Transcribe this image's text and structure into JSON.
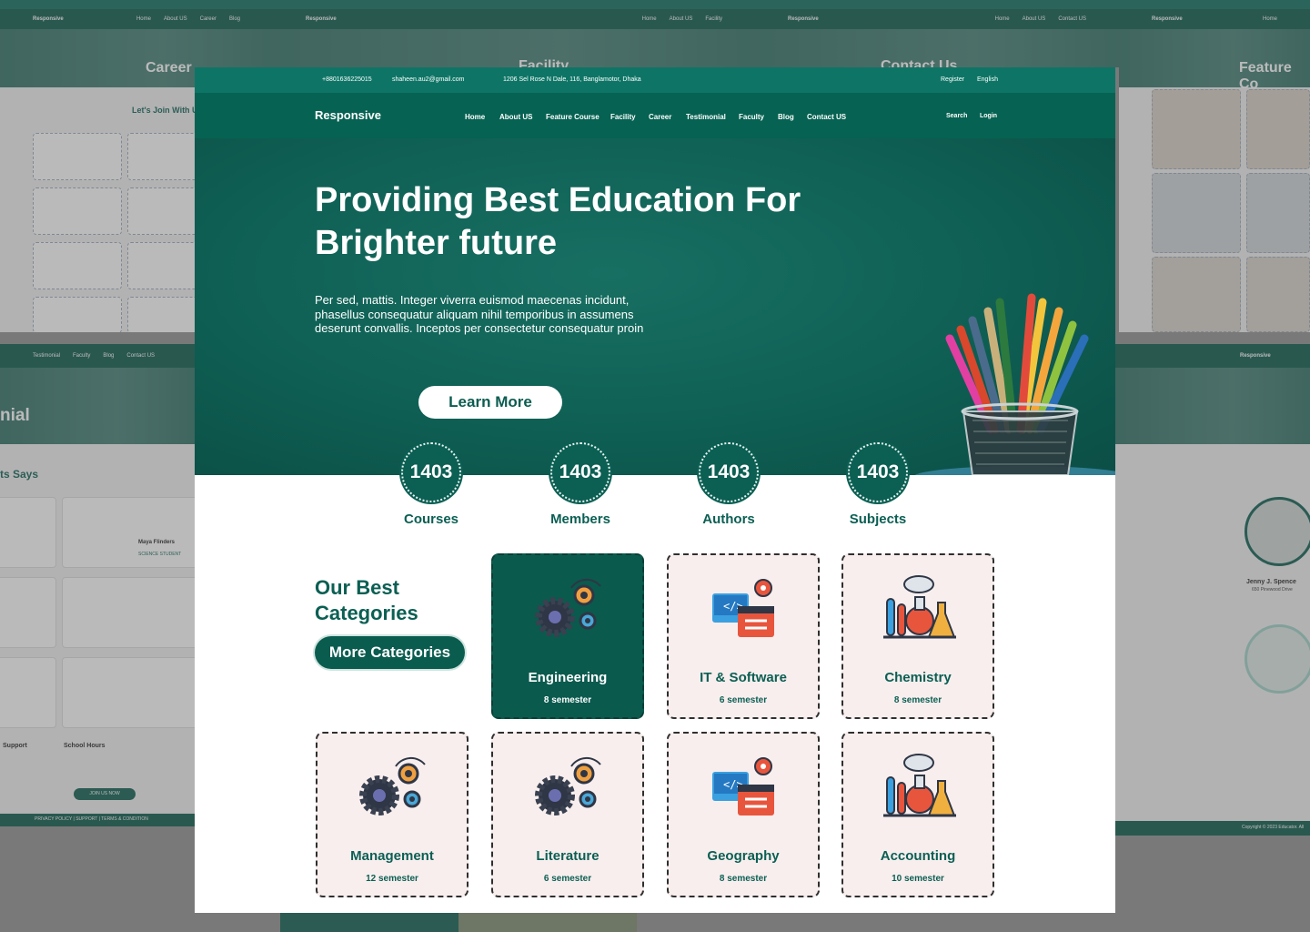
{
  "topbar": {
    "phone": "+8801636225015",
    "email": "shaheen.au2@gmail.com",
    "address": "1206 Sel Rose N Dale, 116, Banglamotor, Dhaka",
    "register": "Register",
    "language": "English"
  },
  "navbar": {
    "brand": "Responsive",
    "links": [
      "Home",
      "About US",
      "Feature Course",
      "Facility",
      "Career",
      "Testimonial",
      "Faculty",
      "Blog",
      "Contact US"
    ],
    "search": "Search",
    "login": "Login"
  },
  "hero": {
    "title_line1": "Providing Best Education For",
    "title_line2": "Brighter future",
    "description": "Per sed, mattis. Integer viverra euismod maecenas incidunt, phasellus consequatur aliquam nihil temporibus in assumens deserunt convallis. Inceptos per consectetur consequatur proin",
    "button": "Learn More"
  },
  "stats": [
    {
      "value": "1403",
      "label": "Courses"
    },
    {
      "value": "1403",
      "label": "Members"
    },
    {
      "value": "1403",
      "label": "Authors"
    },
    {
      "value": "1403",
      "label": "Subjects"
    }
  ],
  "categories_section": {
    "heading_line1": "Our Best",
    "heading_line2": "Categories",
    "button": "More Categories"
  },
  "categories": [
    {
      "name": "Engineering",
      "semester": "8 semester",
      "icon": "gears-icon",
      "active": true
    },
    {
      "name": "IT & Software",
      "semester": "6 semester",
      "icon": "code-window-icon"
    },
    {
      "name": "Chemistry",
      "semester": "8 semester",
      "icon": "flask-icon"
    },
    {
      "name": "Management",
      "semester": "12 semester",
      "icon": "gears-icon"
    },
    {
      "name": "Literature",
      "semester": "6 semester",
      "icon": "gears-icon"
    },
    {
      "name": "Geography",
      "semester": "8 semester",
      "icon": "code-window-icon"
    },
    {
      "name": "Accounting",
      "semester": "10 semester",
      "icon": "flask-icon"
    }
  ],
  "background": {
    "career_title": "Career",
    "facility_title": "Facility",
    "contact_title": "Contact Us",
    "feature_title": "Feature Co",
    "testimonial_title": "nial",
    "says_title": "ts Says",
    "join_title": "Let's Join With U",
    "profile_name": "Jenny J. Spence",
    "profile_address": "650 Pinewood Drive",
    "quote_name": "Maya Flinders",
    "quote_role": "SCIENCE STUDENT",
    "footer_links": "PRIVACY POLICY  |  SUPPORT  |  TERMS & CONDITION",
    "copyright": "Copyright © 2023 Educator. All",
    "support": "Support",
    "school_hours": "School Hours",
    "join_now": "JOIN US NOW"
  },
  "colors": {
    "primary": "#066252",
    "accent": "#0e7566",
    "card_bg": "#f8eeee"
  }
}
